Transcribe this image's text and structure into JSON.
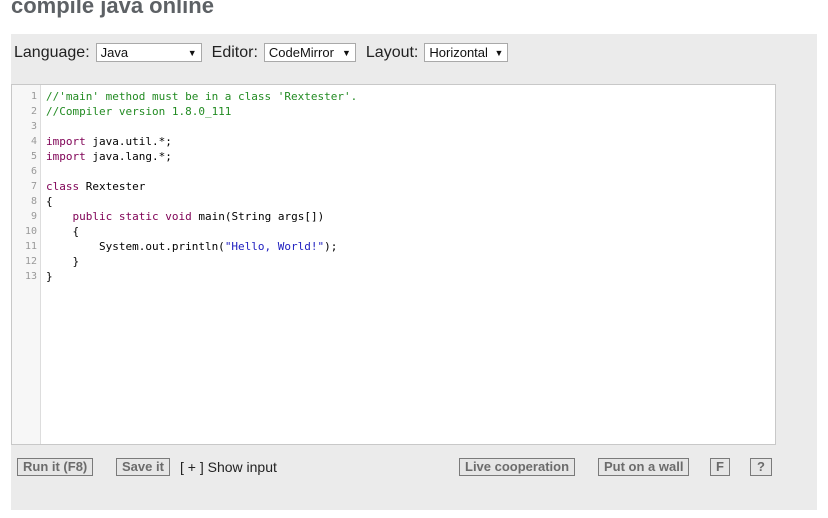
{
  "header": {
    "title": "compile java online"
  },
  "toolbar": {
    "language_label": "Language:",
    "language_value": "Java",
    "editor_label": "Editor:",
    "editor_value": "CodeMirror",
    "layout_label": "Layout:",
    "layout_value": "Horizontal",
    "dropdown_arrow": "▼"
  },
  "editor": {
    "line_numbers": [
      "1",
      "2",
      "3",
      "4",
      "5",
      "6",
      "7",
      "8",
      "9",
      "10",
      "11",
      "12",
      "13"
    ],
    "lines": [
      "//'main' method must be in a class 'Rextester'.",
      "//Compiler version 1.8.0_111",
      "",
      "import java.util.*;",
      "import java.lang.*;",
      "",
      "class Rextester",
      "{",
      "    public static void main(String args[])",
      "    {",
      "        System.out.println(\"Hello, World!\");",
      "    }",
      "}"
    ]
  },
  "actions": {
    "run_label": "Run it (F8)",
    "save_label": "Save it",
    "show_input_label": "[ + ] Show input",
    "live_coop_label": "Live cooperation",
    "wall_label": "Put on a wall",
    "f_label": "F",
    "help_label": "?"
  },
  "colors": {
    "panel_bg": "#ebebeb",
    "title": "#5d6165",
    "comment": "#228b22",
    "keyword": "#7f0055",
    "string": "#2020c0"
  }
}
